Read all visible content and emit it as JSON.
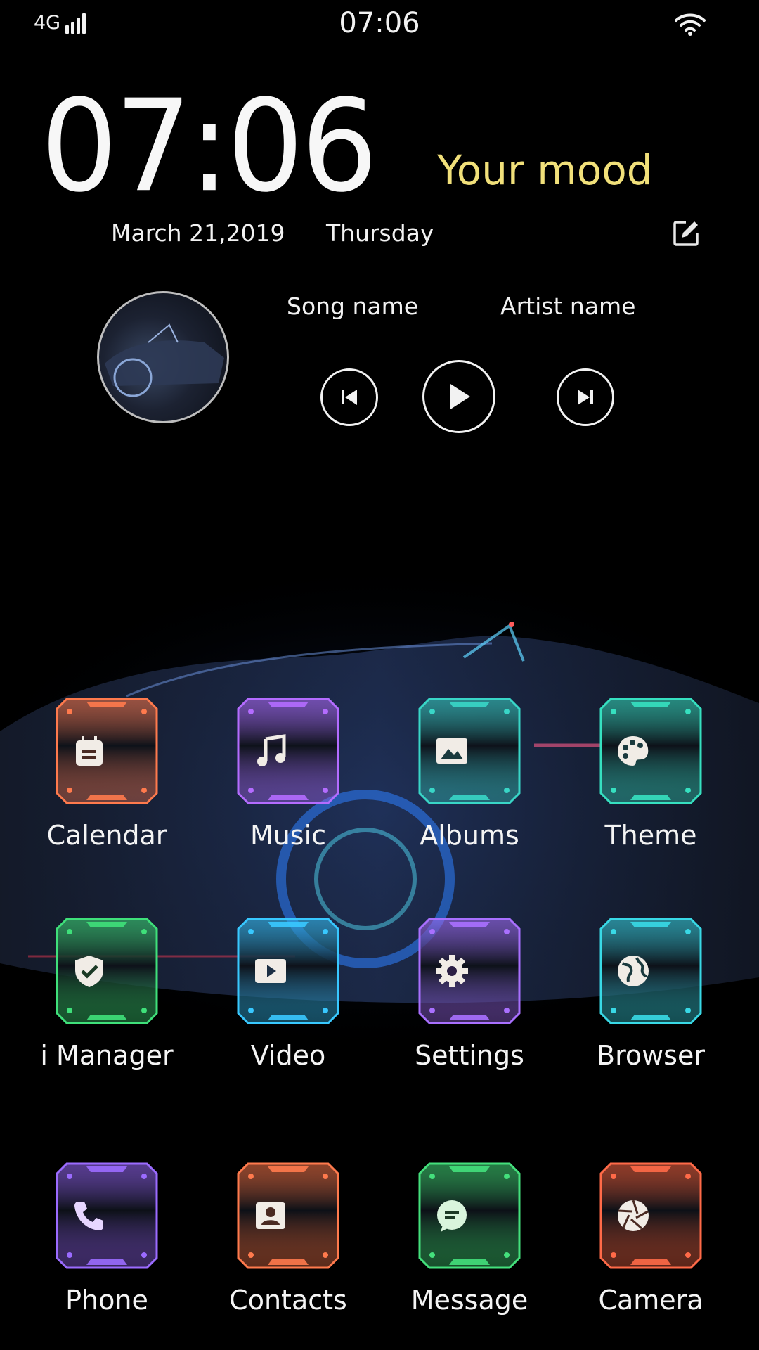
{
  "status_bar": {
    "network": "4G",
    "time": "07:06",
    "wifi_icon": "wifi-icon",
    "signal_icon": "signal-bars-icon"
  },
  "widget": {
    "clock": "07:06",
    "mood": "Your mood",
    "date": "March 21,2019",
    "weekday": "Thursday",
    "edit_icon": "edit-icon"
  },
  "music": {
    "song": "Song name",
    "artist": "Artist name",
    "prev_icon": "skip-previous-icon",
    "play_icon": "play-icon",
    "next_icon": "skip-next-icon"
  },
  "apps": [
    {
      "label": "Calendar",
      "icon": "calendar-icon",
      "color": "#ff7a4d"
    },
    {
      "label": "Music",
      "icon": "music-note-icon",
      "color": "#b46cff"
    },
    {
      "label": "Albums",
      "icon": "image-icon",
      "color": "#39d6c7"
    },
    {
      "label": "Theme",
      "icon": "palette-icon",
      "color": "#36e0c0"
    },
    {
      "label": "i Manager",
      "icon": "shield-check-icon",
      "color": "#3fe07a"
    },
    {
      "label": "Video",
      "icon": "play-video-icon",
      "color": "#38c8ff"
    },
    {
      "label": "Settings",
      "icon": "gear-icon",
      "color": "#a970ff"
    },
    {
      "label": "Browser",
      "icon": "globe-icon",
      "color": "#39d9e6"
    }
  ],
  "dock": [
    {
      "label": "Phone",
      "icon": "phone-icon",
      "color": "#9b6bff"
    },
    {
      "label": "Contacts",
      "icon": "contact-card-icon",
      "color": "#ff7a4d"
    },
    {
      "label": "Message",
      "icon": "chat-bubble-icon",
      "color": "#44e07c"
    },
    {
      "label": "Camera",
      "icon": "camera-shutter-icon",
      "color": "#ff6a48"
    }
  ]
}
